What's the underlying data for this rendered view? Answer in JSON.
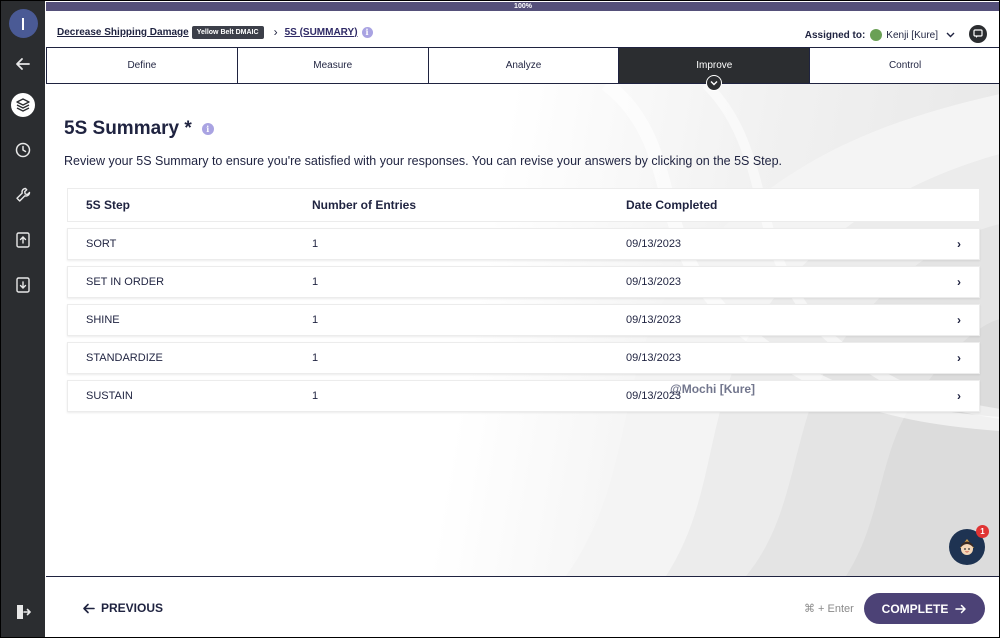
{
  "progress": {
    "label": "100%",
    "percent": 100
  },
  "breadcrumb": {
    "project": "Decrease Shipping Damage",
    "badge": "Yellow Belt DMAIC",
    "separator": "›",
    "current": "5S (SUMMARY)",
    "info": "i"
  },
  "assigned": {
    "label": "Assigned to:",
    "user": "Kenji [Kure]"
  },
  "tabs": [
    {
      "label": "Define"
    },
    {
      "label": "Measure"
    },
    {
      "label": "Analyze"
    },
    {
      "label": "Improve",
      "active": true
    },
    {
      "label": "Control"
    }
  ],
  "page": {
    "title": "5S Summary *",
    "info": "i",
    "intro": "Review your 5S Summary to ensure you're satisfied with your responses. You can revise your answers by clicking on the 5S Step."
  },
  "table": {
    "headers": [
      "5S Step",
      "Number of Entries",
      "Date Completed"
    ],
    "rows": [
      {
        "step": "SORT",
        "entries": "1",
        "date": "09/13/2023",
        "arrow": "›"
      },
      {
        "step": "SET IN ORDER",
        "entries": "1",
        "date": "09/13/2023",
        "arrow": "›"
      },
      {
        "step": "SHINE",
        "entries": "1",
        "date": "09/13/2023",
        "arrow": "›"
      },
      {
        "step": "STANDARDIZE",
        "entries": "1",
        "date": "09/13/2023",
        "arrow": "›"
      },
      {
        "step": "SUSTAIN",
        "entries": "1",
        "date": "09/13/2023",
        "arrow": "›"
      }
    ]
  },
  "watermark": "@Mochi [Kure]",
  "notification_count": "1",
  "footer": {
    "previous": "PREVIOUS",
    "shortcut": "⌘ + Enter",
    "complete": "COMPLETE"
  },
  "colors": {
    "sidebar": "#2b2d30",
    "accent": "#4c4276",
    "text": "#1f2340",
    "progress": "#55507a"
  },
  "sidebar_icons": [
    "logo",
    "back-arrow-icon",
    "layers-icon",
    "clock-icon",
    "wrench-icon",
    "upload-icon",
    "download-icon",
    "logout-icon"
  ]
}
